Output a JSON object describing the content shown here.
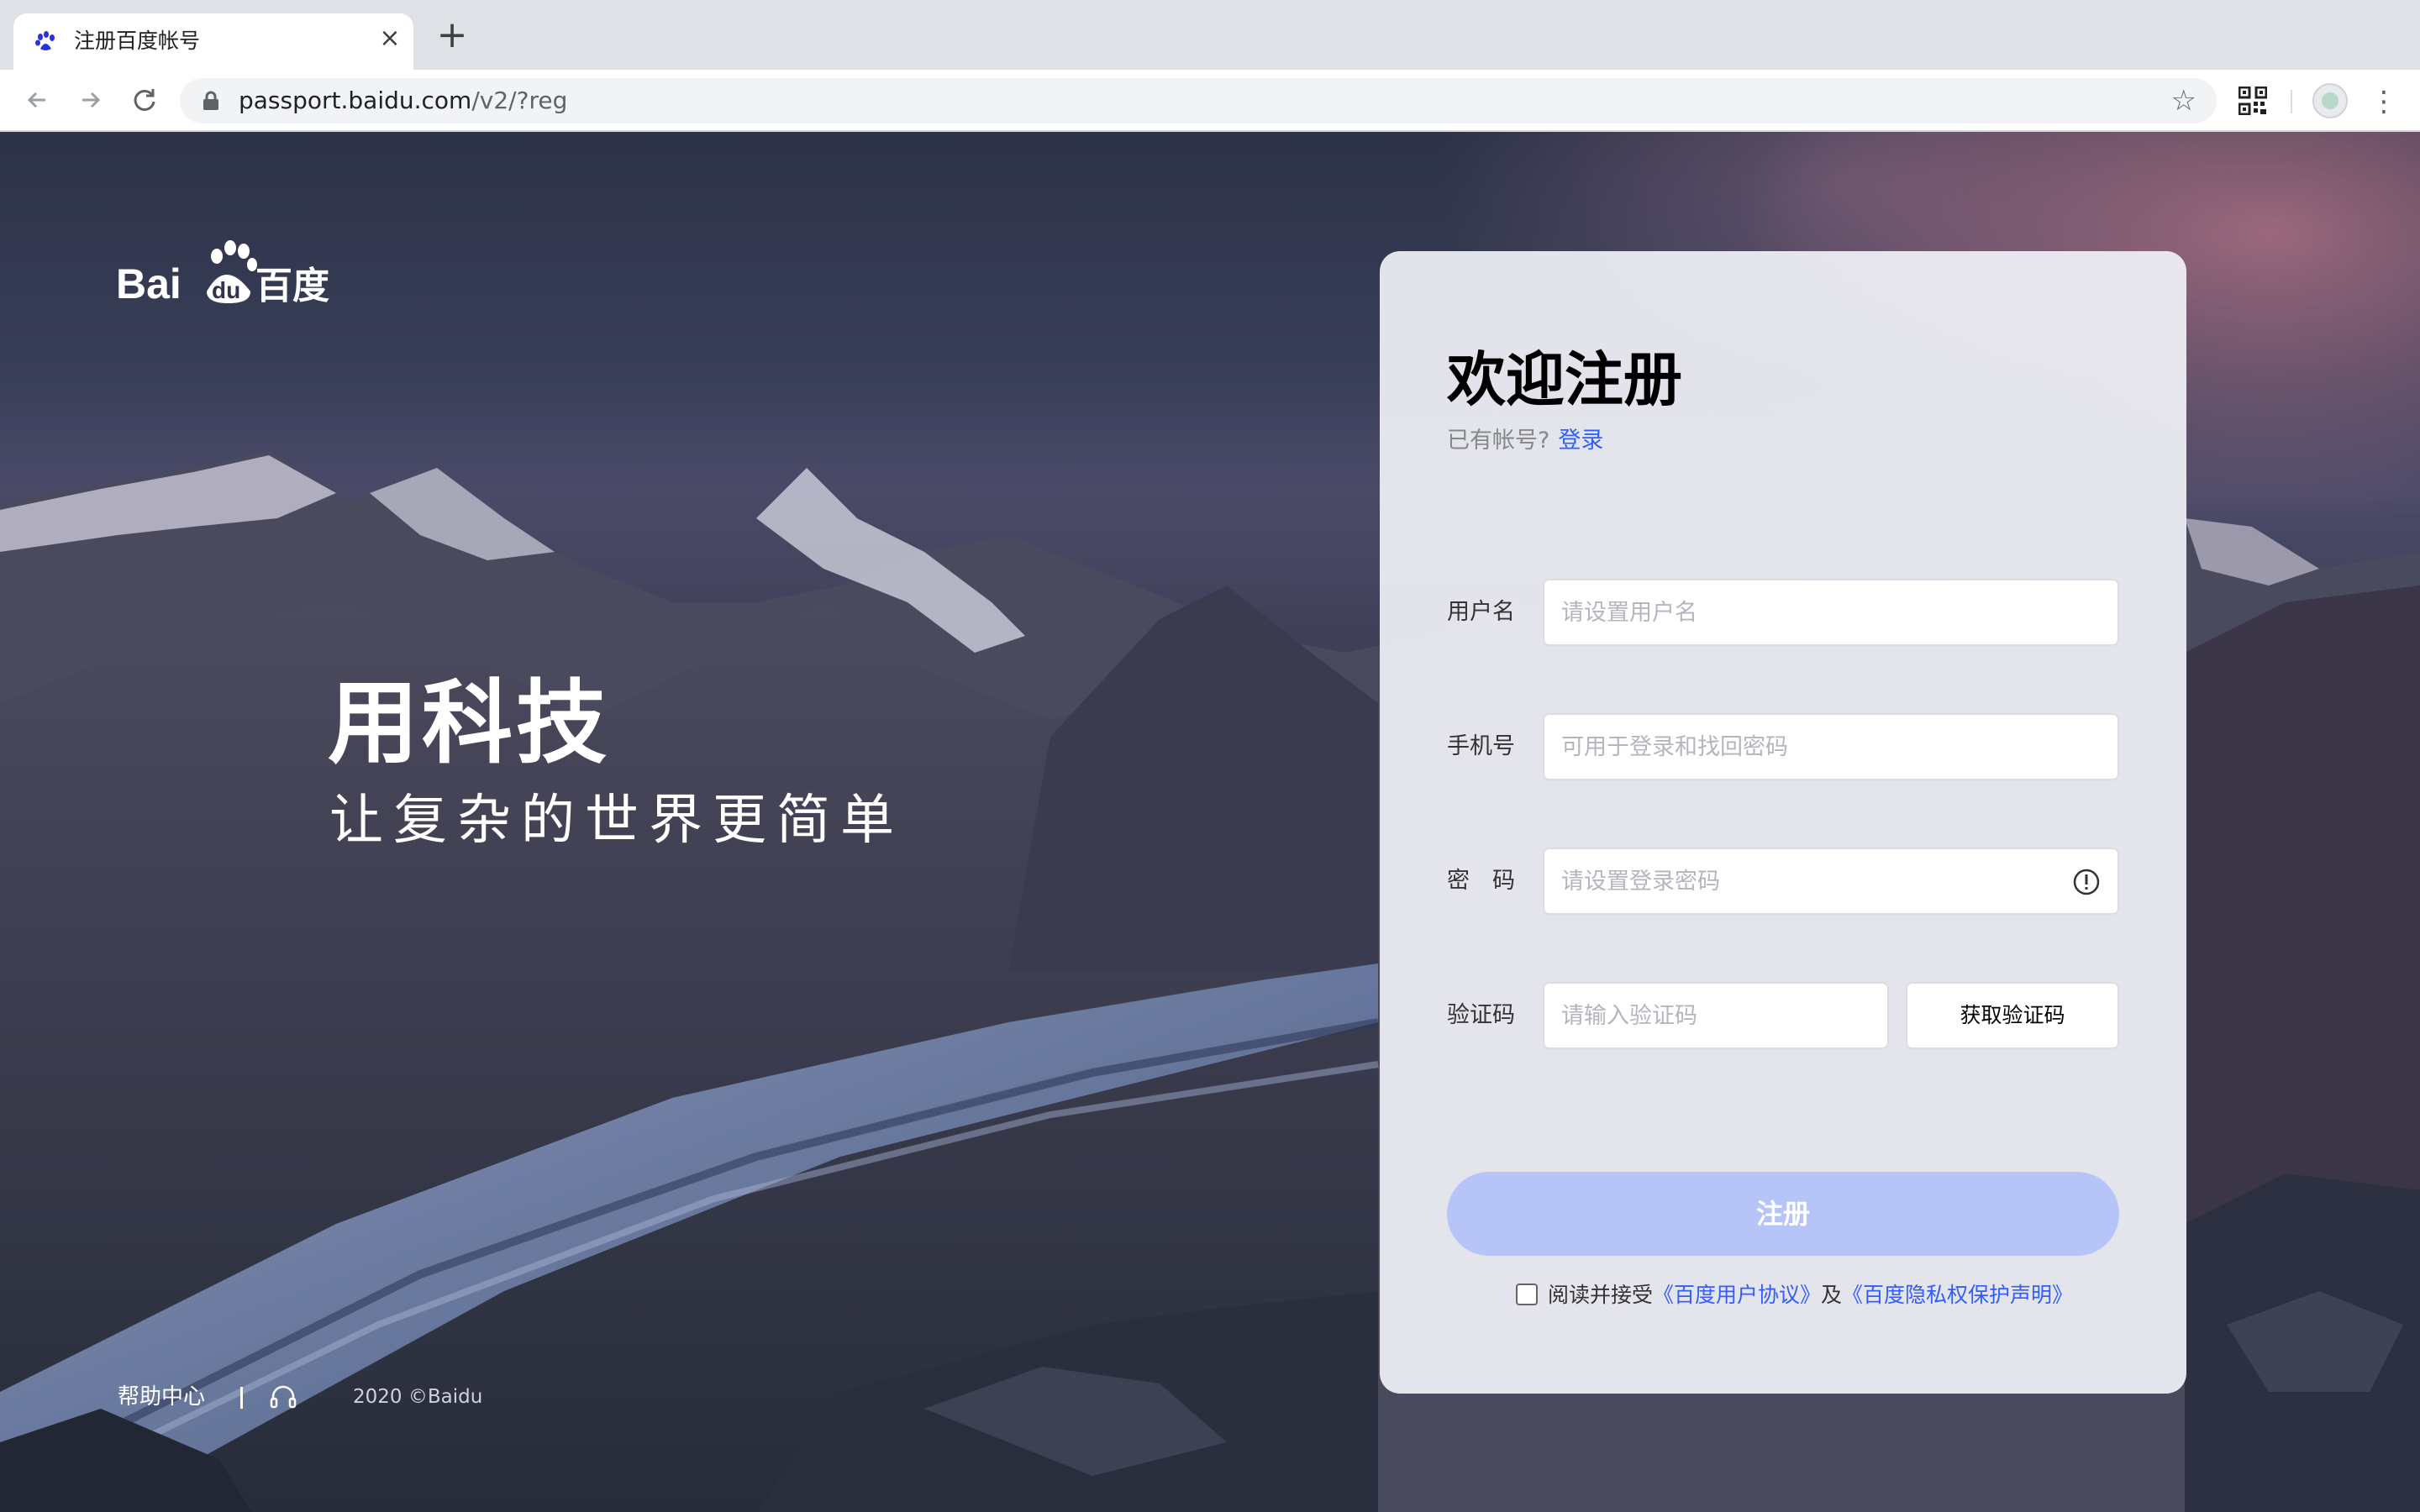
{
  "browser": {
    "tab_title": "注册百度帐号",
    "tab_close": "×",
    "new_tab": "+",
    "url_host": "passport.baidu.com",
    "url_path": "/v2/?reg"
  },
  "page": {
    "logo_text": "Bai du 百度",
    "slogan_main": "用科技",
    "slogan_sub": "让复杂的世界更简单",
    "footer": {
      "help": "帮助中心",
      "copyright": "2020 ©Baidu"
    }
  },
  "card": {
    "title": "欢迎注册",
    "have_account": "已有帐号?",
    "login_link": "登录",
    "fields": {
      "username": {
        "label": "用户名",
        "placeholder": "请设置用户名"
      },
      "phone": {
        "label": "手机号",
        "placeholder": "可用于登录和找回密码"
      },
      "password": {
        "label": "密　码",
        "placeholder": "请设置登录密码"
      },
      "code": {
        "label": "验证码",
        "placeholder": "请输入验证码",
        "button": "获取验证码"
      }
    },
    "submit": "注册",
    "agreement": {
      "prefix": "阅读并接受",
      "user_agreement": "《百度用户协议》",
      "and": "及",
      "privacy": "《百度隐私权保护声明》"
    }
  },
  "colors": {
    "accent": "#315efb",
    "submit_bg": "#b7c4f7",
    "card_bg": "#f0f1f6"
  }
}
